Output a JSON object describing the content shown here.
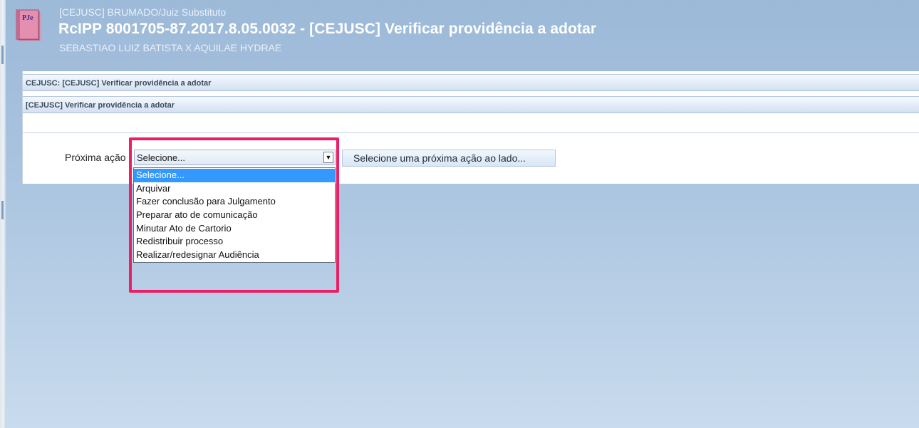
{
  "header": {
    "subtitle": "[CEJUSC] BRUMADO/Juiz Substituto",
    "title": "RcIPP 8001705-87.2017.8.05.0032 - [CEJUSC] Verificar providência a adotar",
    "parties": "SEBASTIAO LUIZ BATISTA X AQUILAE HYDRAE",
    "logo_text": "PJe"
  },
  "panel": {
    "section_title": "CEJUSC: [CEJUSC] Verificar providência a adotar",
    "subsection_title": "[CEJUSC] Verificar providência a adotar"
  },
  "form": {
    "label": "Próxima ação",
    "select_value": "Selecione...",
    "action_button_label": "Selecione uma próxima ação ao lado...",
    "options": [
      "Selecione...",
      "Arquivar",
      "Fazer conclusão para Julgamento",
      "Preparar ato de comunicação",
      "Minutar Ato de Cartorio",
      "Redistribuir processo",
      "Realizar/redesignar Audiência"
    ],
    "selected_index": 0
  },
  "colors": {
    "highlight": "#ec1f64",
    "selection": "#3399ff",
    "background": "#a8c2de"
  }
}
